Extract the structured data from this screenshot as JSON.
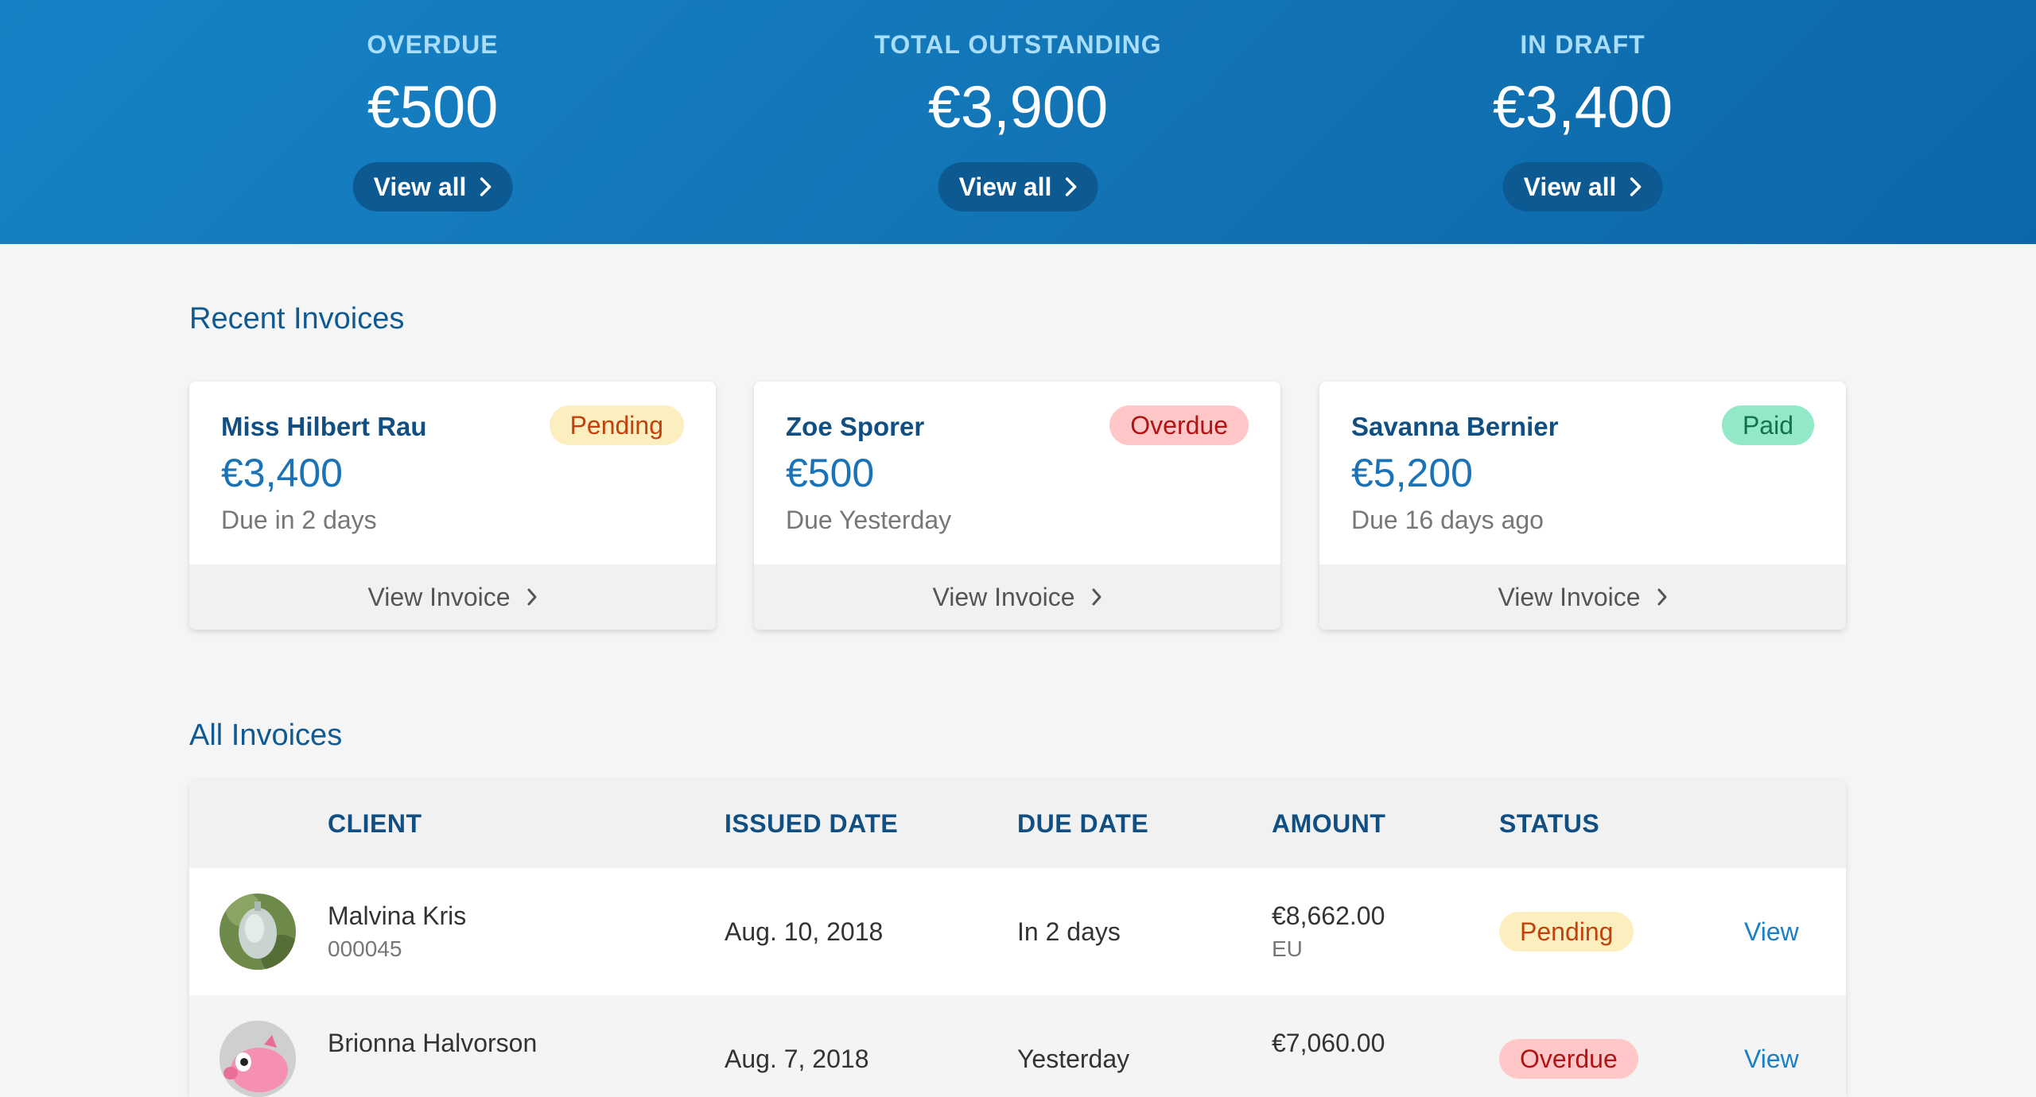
{
  "summary": [
    {
      "label": "OVERDUE",
      "value": "€500",
      "action": "View all"
    },
    {
      "label": "TOTAL OUTSTANDING",
      "value": "€3,900",
      "action": "View all"
    },
    {
      "label": "IN DRAFT",
      "value": "€3,400",
      "action": "View all"
    }
  ],
  "recent": {
    "title": "Recent Invoices",
    "cards": [
      {
        "client": "Miss Hilbert Rau",
        "status": "Pending",
        "amount": "€3,400",
        "due": "Due in 2 days",
        "action": "View Invoice"
      },
      {
        "client": "Zoe Sporer",
        "status": "Overdue",
        "amount": "€500",
        "due": "Due Yesterday",
        "action": "View Invoice"
      },
      {
        "client": "Savanna Bernier",
        "status": "Paid",
        "amount": "€5,200",
        "due": "Due 16 days ago",
        "action": "View Invoice"
      }
    ]
  },
  "all": {
    "title": "All Invoices",
    "columns": [
      "CLIENT",
      "ISSUED DATE",
      "DUE DATE",
      "AMOUNT",
      "STATUS"
    ],
    "rows": [
      {
        "client": "Malvina Kris",
        "number": "000045",
        "issued": "Aug. 10, 2018",
        "due": "In 2 days",
        "amount": "€8,662.00",
        "currency": "EU",
        "status": "Pending",
        "action": "View",
        "avatar": "plant-avatar"
      },
      {
        "client": "Brionna Halvorson",
        "number": "",
        "issued": "Aug. 7, 2018",
        "due": "Yesterday",
        "amount": "€7,060.00",
        "currency": "",
        "status": "Overdue",
        "action": "View",
        "avatar": "piggy-avatar"
      }
    ]
  },
  "colors": {
    "hero_start": "#1582c7",
    "hero_end": "#0c67a8",
    "pending_bg": "#fcefbf",
    "overdue_bg": "#ffc7c7",
    "paid_bg": "#93e8c8",
    "link": "#1a7fc4"
  },
  "icons": {
    "chevron": "chevron-right-icon"
  }
}
